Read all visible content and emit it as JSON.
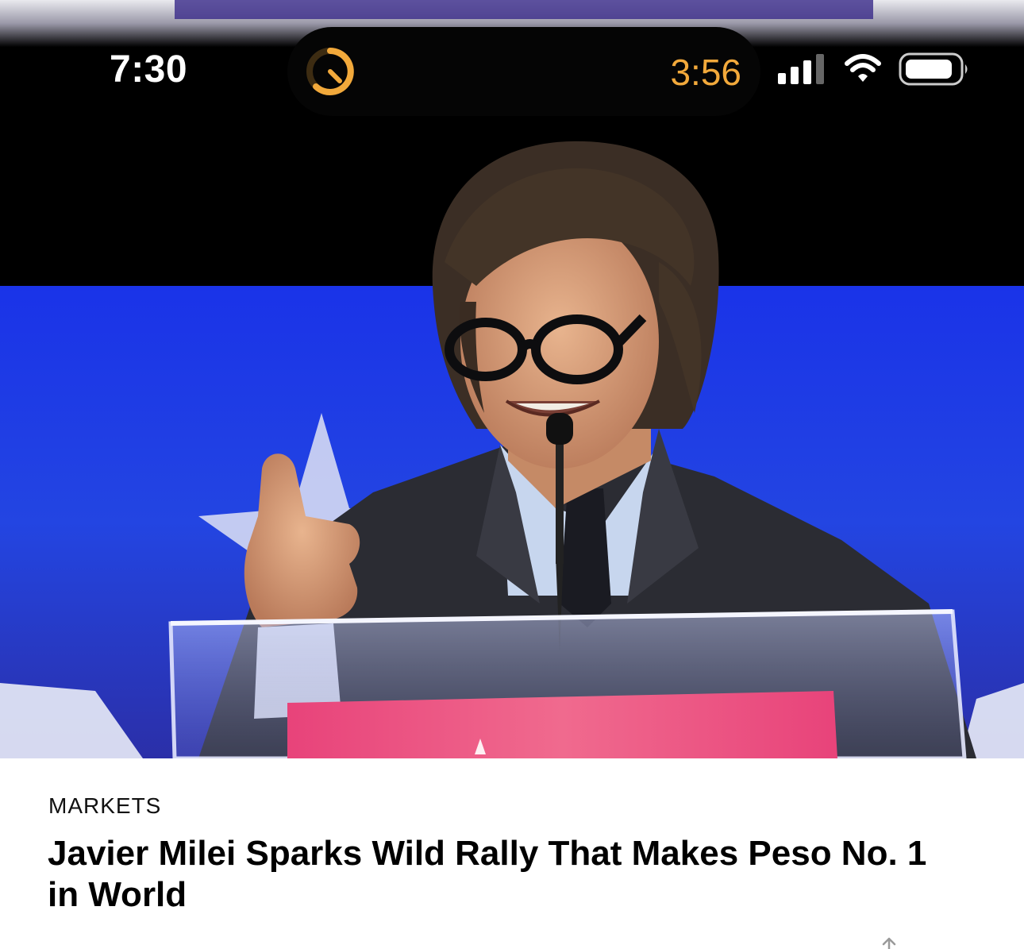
{
  "status_bar": {
    "time": "7:30",
    "live_activity_timer": "3:56",
    "icons": [
      "timer-icon",
      "cellular-signal-icon",
      "wifi-icon",
      "battery-icon"
    ]
  },
  "hero": {
    "image_subject": "speaker-at-podium-photo"
  },
  "article": {
    "category": "MARKETS",
    "headline": "Javier Milei Sparks Wild Rally That Makes Peso No. 1 in World"
  },
  "colors": {
    "timer_accent": "#f2a93b",
    "stage_blue": "#1f3fe0",
    "text": "#000000",
    "background": "#ffffff"
  }
}
